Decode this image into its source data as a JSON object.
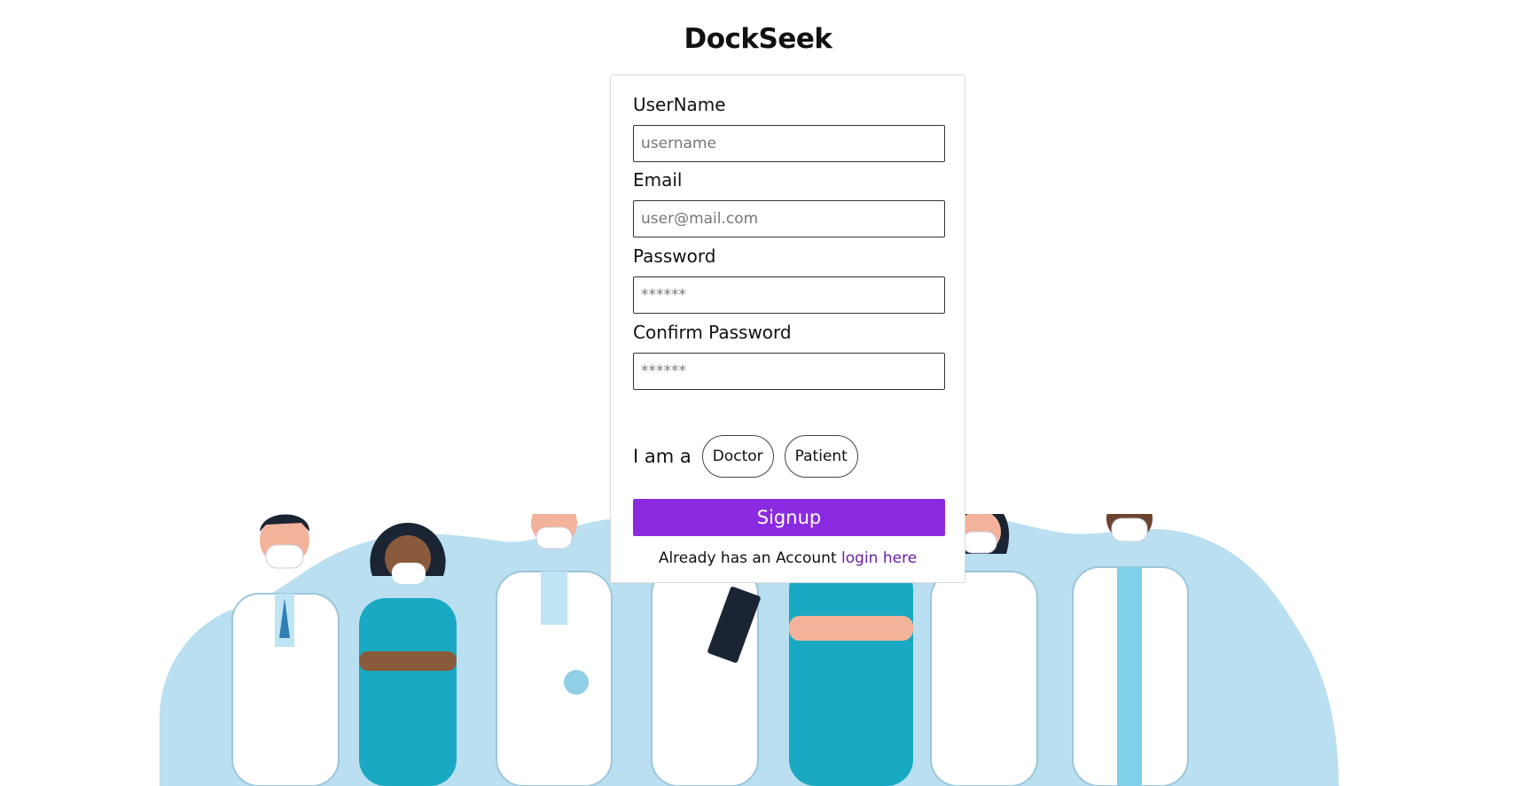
{
  "app": {
    "title": "DockSeek"
  },
  "form": {
    "username": {
      "label": "UserName",
      "placeholder": "username",
      "value": ""
    },
    "email": {
      "label": "Email",
      "placeholder": "user@mail.com",
      "value": ""
    },
    "password": {
      "label": "Password",
      "placeholder": "******",
      "value": ""
    },
    "confirm_password": {
      "label": "Confirm Password",
      "placeholder": "******",
      "value": ""
    },
    "role": {
      "label": "I am a",
      "options": [
        "Doctor",
        "Patient"
      ]
    },
    "signup_label": "Signup",
    "footer": {
      "text": "Already has an Account",
      "link_text": "login here"
    }
  },
  "colors": {
    "accent": "#8a2be2",
    "link": "#6a1fa6",
    "illustration_bg": "#b9dff0",
    "scrubs": "#1aa9c2",
    "coat": "#ffffff"
  }
}
